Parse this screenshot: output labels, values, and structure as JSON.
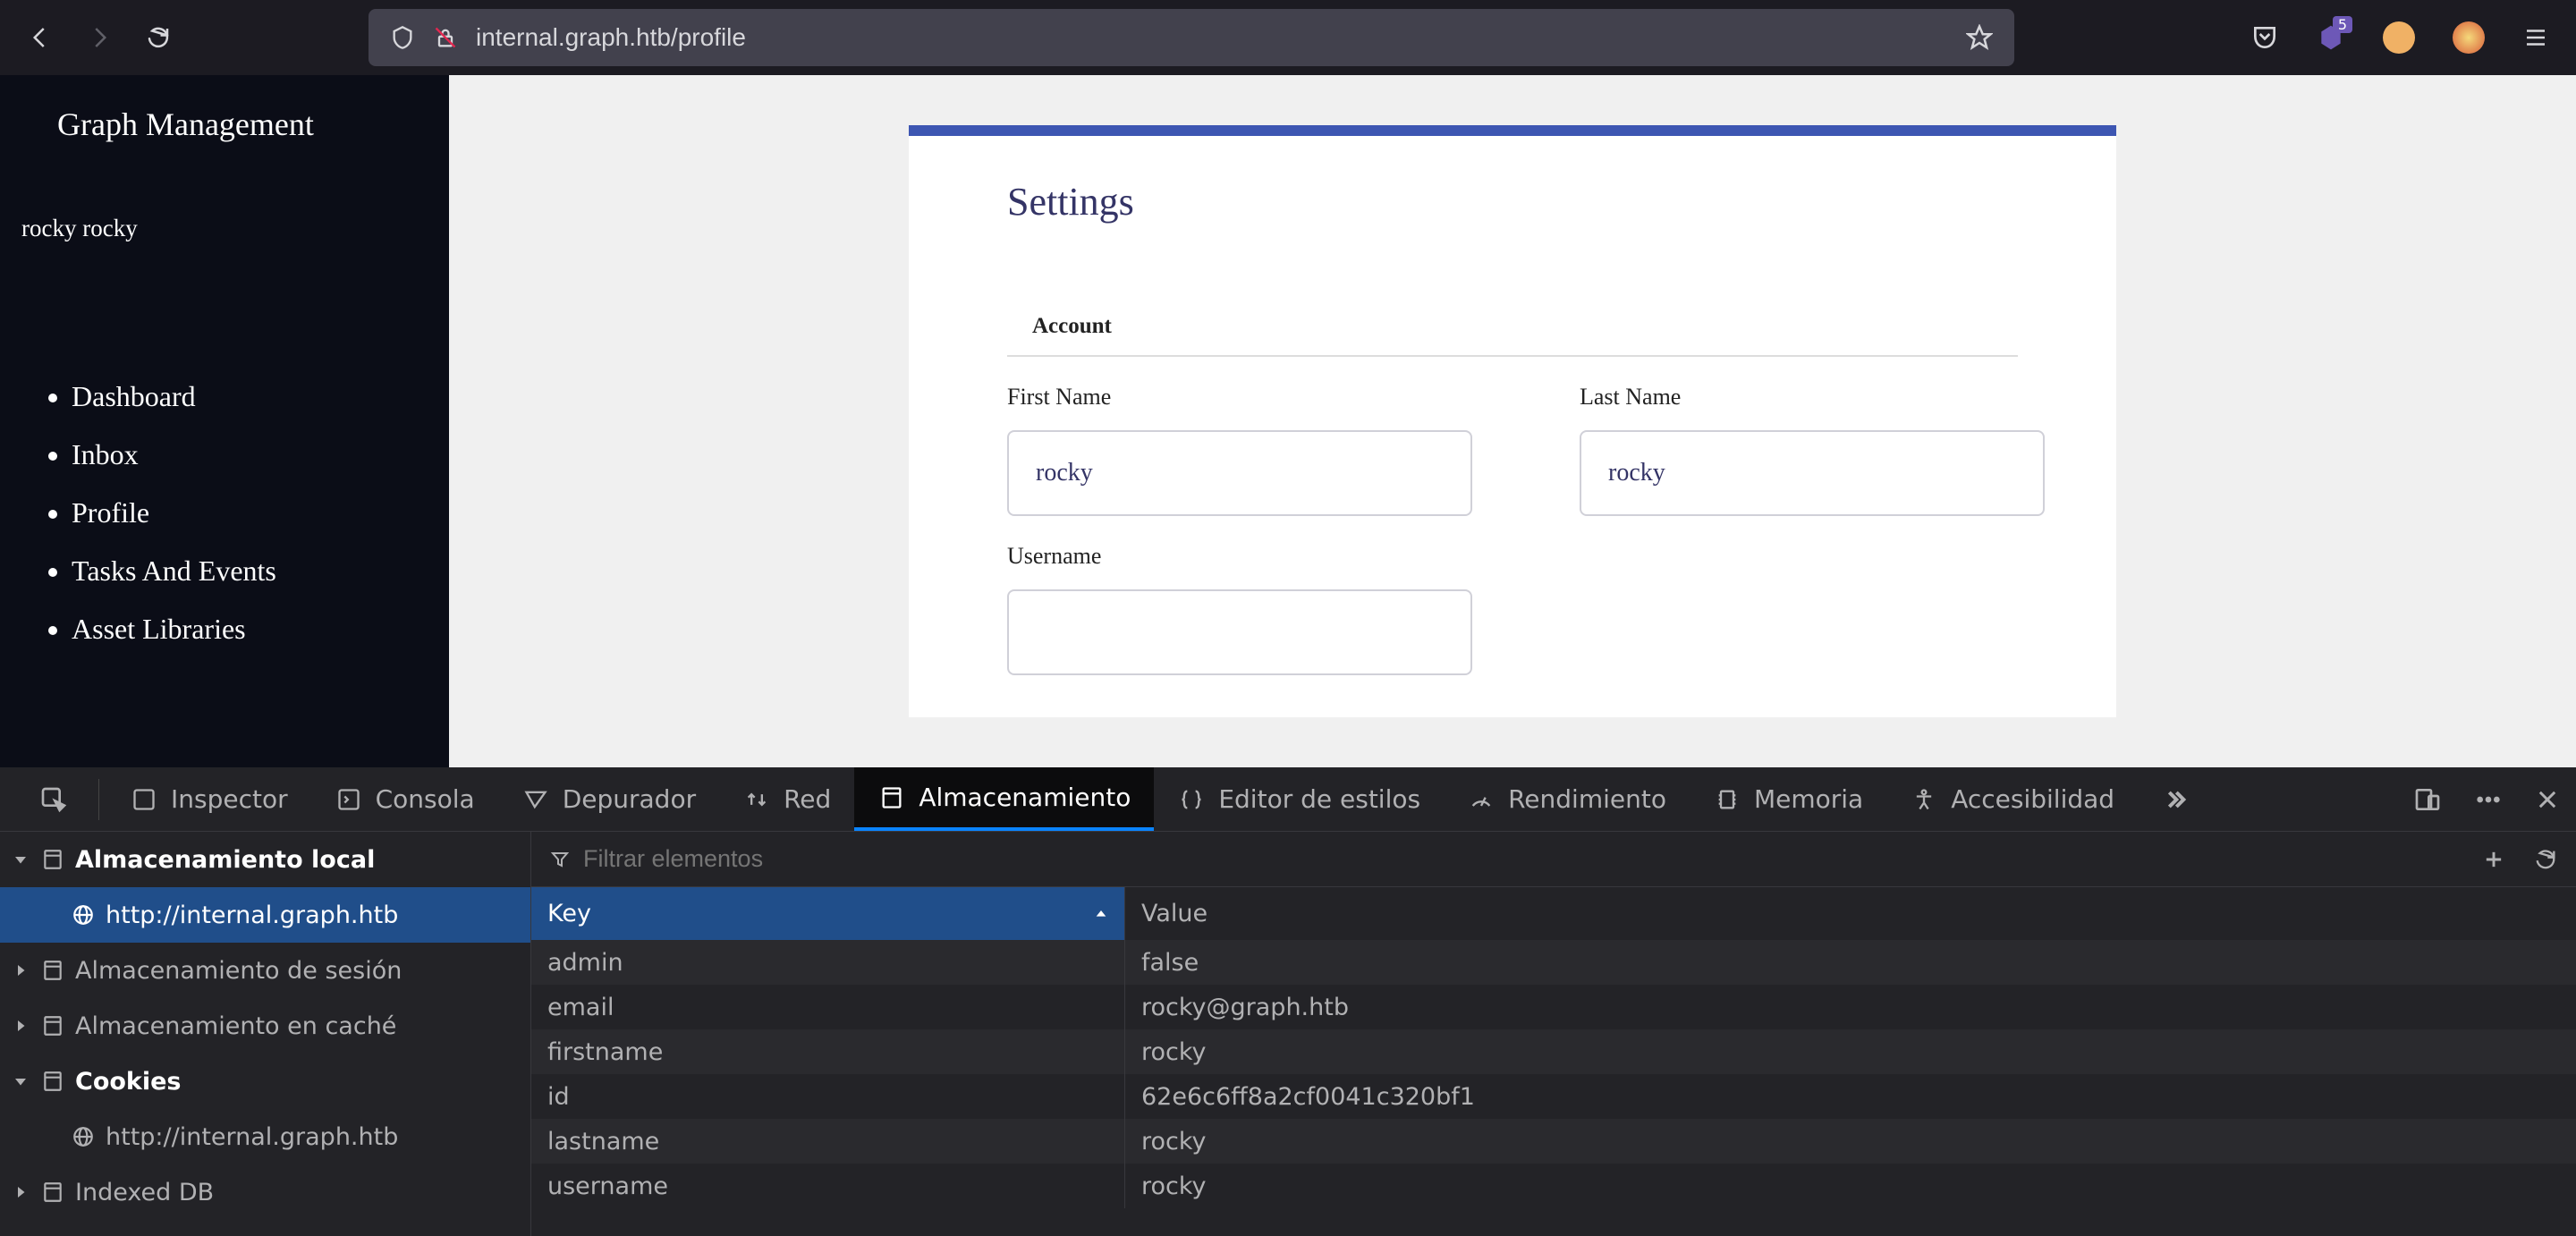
{
  "browser": {
    "url": "internal.graph.htb/profile",
    "badge_count": "5"
  },
  "app": {
    "title": "Graph Management",
    "user_display": "rocky rocky",
    "nav": {
      "dashboard": "Dashboard",
      "inbox": "Inbox",
      "profile": "Profile",
      "tasks": "Tasks And Events",
      "assets": "Asset Libraries"
    }
  },
  "settings": {
    "heading": "Settings",
    "account_heading": "Account",
    "first_name_label": "First Name",
    "first_name_value": "rocky",
    "last_name_label": "Last Name",
    "last_name_value": "rocky",
    "username_label": "Username"
  },
  "devtools": {
    "tabs": {
      "inspector": "Inspector",
      "console": "Consola",
      "debugger": "Depurador",
      "network": "Red",
      "storage": "Almacenamiento",
      "style_editor": "Editor de estilos",
      "performance": "Rendimiento",
      "memory": "Memoria",
      "accessibility": "Accesibilidad"
    },
    "tree": {
      "local_storage": "Almacenamiento local",
      "local_storage_host": "http://internal.graph.htb",
      "session_storage": "Almacenamiento de sesión",
      "cache_storage": "Almacenamiento en caché",
      "cookies": "Cookies",
      "cookies_host": "http://internal.graph.htb",
      "indexed_db": "Indexed DB"
    },
    "filter_placeholder": "Filtrar elementos",
    "columns": {
      "key": "Key",
      "value": "Value"
    },
    "rows": [
      {
        "key": "admin",
        "value": "false"
      },
      {
        "key": "email",
        "value": "rocky@graph.htb"
      },
      {
        "key": "firstname",
        "value": "rocky"
      },
      {
        "key": "id",
        "value": "62e6c6ff8a2cf0041c320bf1"
      },
      {
        "key": "lastname",
        "value": "rocky"
      },
      {
        "key": "username",
        "value": "rocky"
      }
    ]
  }
}
